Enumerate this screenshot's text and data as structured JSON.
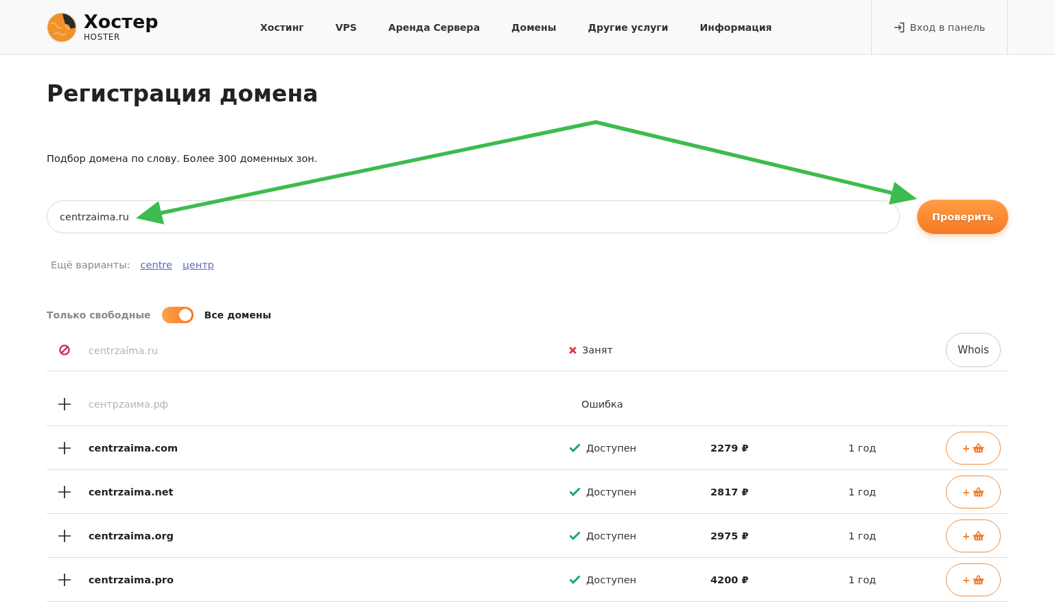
{
  "header": {
    "logo": {
      "title": "Хостер",
      "subtitle": "HOSTER"
    },
    "nav": [
      "Хостинг",
      "VPS",
      "Аренда Сервера",
      "Домены",
      "Другие услуги",
      "Информация"
    ],
    "login": "Вход в панель"
  },
  "domain_search": {
    "title": "Регистрация домена",
    "description": "Подбор домена по слову. Более 300 доменных зон.",
    "search": {
      "value": "centrzaima.ru"
    },
    "submit": "Проверить",
    "suggestions": {
      "label": "Ещё варианты:",
      "links": [
        "centre",
        "центр"
      ]
    }
  },
  "filter": {
    "off_label": "Только свободные",
    "on_label": "Все домены",
    "on": true
  },
  "results": [
    {
      "kind": "taken",
      "domain": "centrzaima.ru",
      "status": "Занят",
      "action": "Whois"
    },
    {
      "kind": "error",
      "domain": "сентрzаима.рф",
      "status": "Ошибка"
    },
    {
      "kind": "available",
      "domain": "centrzaima.com",
      "status": "Доступен",
      "price": "2279 ₽",
      "period": "1 год",
      "action": "+"
    },
    {
      "kind": "available",
      "domain": "centrzaima.net",
      "status": "Доступен",
      "price": "2817 ₽",
      "period": "1 год",
      "action": "+"
    },
    {
      "kind": "available",
      "domain": "centrzaima.org",
      "status": "Доступен",
      "price": "2975 ₽",
      "period": "1 год",
      "action": "+"
    },
    {
      "kind": "available",
      "domain": "centrzaima.pro",
      "status": "Доступен",
      "price": "4200 ₽",
      "period": "1 год",
      "action": "+"
    }
  ]
}
